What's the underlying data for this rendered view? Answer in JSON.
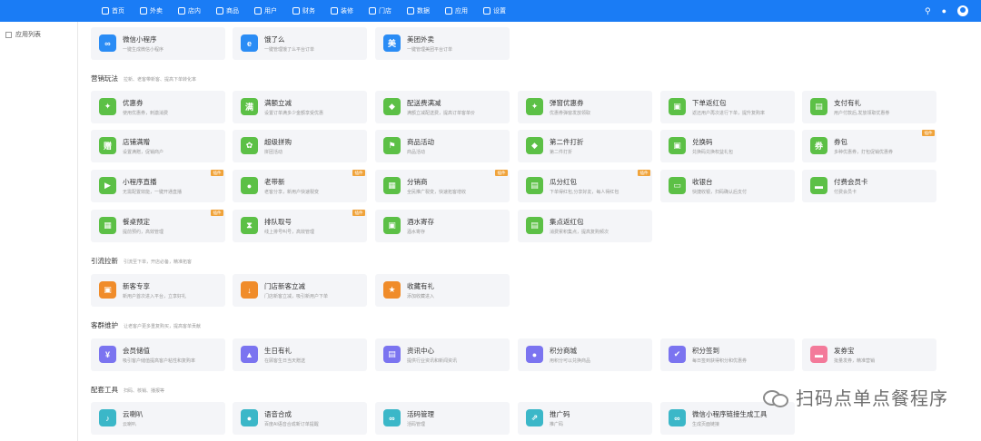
{
  "nav": {
    "items": [
      {
        "label": "首页",
        "icon": "home-icon"
      },
      {
        "label": "外卖",
        "icon": "takeout-icon"
      },
      {
        "label": "店内",
        "icon": "store-icon"
      },
      {
        "label": "商品",
        "icon": "goods-icon"
      },
      {
        "label": "用户",
        "icon": "user-icon"
      },
      {
        "label": "财务",
        "icon": "finance-icon"
      },
      {
        "label": "装修",
        "icon": "decor-icon"
      },
      {
        "label": "门店",
        "icon": "shop-icon"
      },
      {
        "label": "数据",
        "icon": "data-icon"
      },
      {
        "label": "应用",
        "icon": "apps-icon"
      },
      {
        "label": "设置",
        "icon": "settings-icon"
      }
    ]
  },
  "sidebar": {
    "item": "应用列表"
  },
  "channels": [
    {
      "title": "微信小程序",
      "desc": "一键生成微信小程序"
    },
    {
      "title": "饿了么",
      "desc": "一键管理饿了么平台订单"
    },
    {
      "title": "美团外卖",
      "desc": "一键管理美团平台订单"
    }
  ],
  "sections": {
    "marketing": {
      "title": "营销玩法",
      "desc": "拉新、老客带新客、提高下单转化率"
    },
    "traffic": {
      "title": "引流拉新",
      "desc": "引流至下单，开店必备，精准拓客"
    },
    "retention": {
      "title": "客群维护",
      "desc": "让老客户更多重复购买，提高客单贡献"
    },
    "tools": {
      "title": "配套工具",
      "desc": "扫码、核销、播报等"
    }
  },
  "badge_label": "插件",
  "marketing_cards": [
    {
      "title": "优惠券",
      "desc": "使用优惠券，刺激消费"
    },
    {
      "title": "满额立减",
      "desc": "设置订单满多少金额享受优惠"
    },
    {
      "title": "配送费满减",
      "desc": "满额立减配送费，提高订单客单价"
    },
    {
      "title": "弹窗优惠券",
      "desc": "优惠券弹窗发放领取"
    },
    {
      "title": "下单返红包",
      "desc": "返还用户再次进行下单，提升复购率"
    },
    {
      "title": "支付有礼",
      "desc": "用户付款后,发放领取优惠券"
    },
    {
      "title": "店铺满赠",
      "desc": "设置满赠，促销商户"
    },
    {
      "title": "超级拼购",
      "desc": "拼团活动"
    },
    {
      "title": "商品活动",
      "desc": "商品活动"
    },
    {
      "title": "第二件打折",
      "desc": "第二件打折"
    },
    {
      "title": "兑换码",
      "desc": "兑换码兑换权益礼包"
    },
    {
      "title": "券包",
      "desc": "多种优惠券，打包促销优惠券"
    },
    {
      "title": "小程序直播",
      "desc": "无需配置效能，一键开通直播"
    },
    {
      "title": "老带新",
      "desc": "老客分享，新用户快速裂变"
    },
    {
      "title": "分销商",
      "desc": "全民推广裂变，快速拓客增收"
    },
    {
      "title": "瓜分红包",
      "desc": "下单得红包,分享好友，每人得红包"
    },
    {
      "title": "收银台",
      "desc": "快捷收银，扫码确认后支付"
    },
    {
      "title": "付费会员卡",
      "desc": "付费会员卡"
    },
    {
      "title": "餐桌预定",
      "desc": "提前预约，高效管理"
    },
    {
      "title": "排队取号",
      "desc": "线上排号叫号，高效管理"
    },
    {
      "title": "酒水寄存",
      "desc": "酒水寄存"
    },
    {
      "title": "集点返红包",
      "desc": "消费累积集点，提高复购频次"
    }
  ],
  "traffic_cards": [
    {
      "title": "新客专享",
      "desc": "新用户首次进入平台，立享好礼"
    },
    {
      "title": "门店新客立减",
      "desc": "门店新客立减，吸引新用户下单"
    },
    {
      "title": "收藏有礼",
      "desc": "添加收藏进入"
    }
  ],
  "retention_cards": [
    {
      "title": "会员储值",
      "desc": "吸引客户储值提高客户粘性和复购率"
    },
    {
      "title": "生日有礼",
      "desc": "在顾客生日当天赠送"
    },
    {
      "title": "资讯中心",
      "desc": "提供行业资讯和新闻资讯"
    },
    {
      "title": "积分商城",
      "desc": "用积分可以兑换商品"
    },
    {
      "title": "积分签到",
      "desc": "每日签到获得积分和优惠券"
    },
    {
      "title": "发券宝",
      "desc": "批量发券，精准营销"
    }
  ],
  "tool_cards": [
    {
      "title": "云喇叭",
      "desc": "云喇叭"
    },
    {
      "title": "语音合成",
      "desc": "百度AI语音合成新订单提醒"
    },
    {
      "title": "活码管理",
      "desc": "活码管理"
    },
    {
      "title": "推广码",
      "desc": "推广码"
    },
    {
      "title": "微信小程序链接生成工具",
      "desc": "生成页面链接"
    }
  ],
  "watermark": "扫码点单点餐程序"
}
